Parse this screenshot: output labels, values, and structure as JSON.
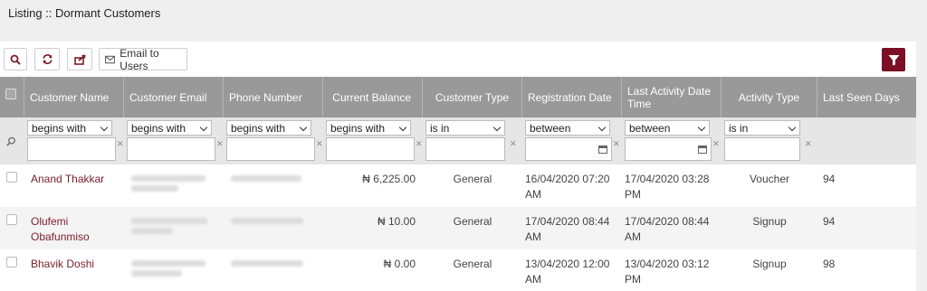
{
  "page": {
    "title": "Listing :: Dormant Customers"
  },
  "toolbar": {
    "search_icon": "search-icon",
    "refresh_icon": "refresh-icon",
    "export_icon": "export-icon",
    "email_label": "Email to Users",
    "filter_icon": "filter-icon"
  },
  "colors": {
    "accent": "#7b1024",
    "header_bg": "#999999",
    "filter_bg": "#e6e6e6",
    "link": "#7b1e2a"
  },
  "columns": [
    "Customer Name",
    "Customer Email",
    "Phone Number",
    "Current Balance",
    "Customer Type",
    "Registration Date",
    "Last Activity Date Time",
    "Activity Type",
    "Last Seen Days"
  ],
  "filters": [
    "begins with",
    "begins with",
    "begins with",
    "begins with",
    "is in",
    "between",
    "between",
    "is in"
  ],
  "rows": [
    {
      "name": "Anand Thakkar",
      "balance": "₦ 6,225.00",
      "type": "General",
      "registration": "16/04/2020 07:20 AM",
      "last_activity": "17/04/2020 03:28 PM",
      "activity_type": "Voucher",
      "last_seen": "94"
    },
    {
      "name": "Olufemi Obafunmiso",
      "balance": "₦ 10.00",
      "type": "General",
      "registration": "17/04/2020 08:44 AM",
      "last_activity": "17/04/2020 08:44 AM",
      "activity_type": "Signup",
      "last_seen": "94"
    },
    {
      "name": "Bhavik Doshi",
      "balance": "₦ 0.00",
      "type": "General",
      "registration": "13/04/2020 12:00 AM",
      "last_activity": "13/04/2020 03:12 PM",
      "activity_type": "Signup",
      "last_seen": "98"
    }
  ]
}
